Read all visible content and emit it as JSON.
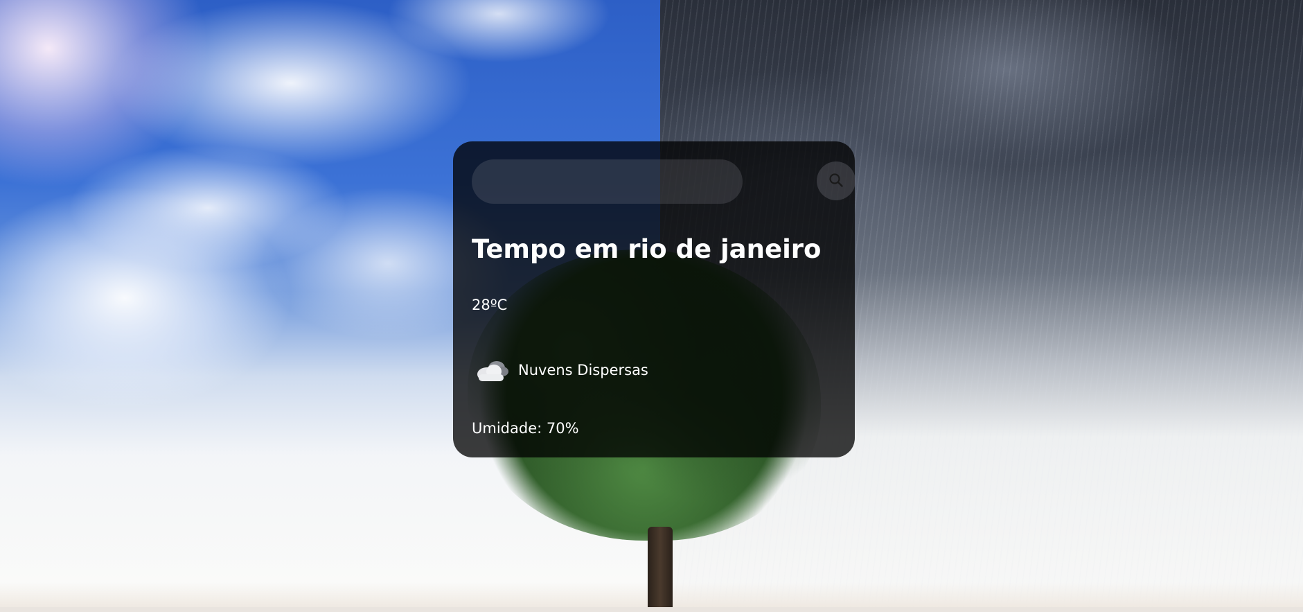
{
  "search": {
    "value": "",
    "placeholder": "",
    "button_icon": "search-icon"
  },
  "weather": {
    "title": "Tempo em rio de janeiro",
    "temperature": "28ºC",
    "condition_icon": "scattered-clouds-icon",
    "description": "Nuvens Dispersas",
    "humidity": "Umidade: 70%"
  },
  "colors": {
    "card_background": "#000000",
    "text": "#ffffff"
  }
}
